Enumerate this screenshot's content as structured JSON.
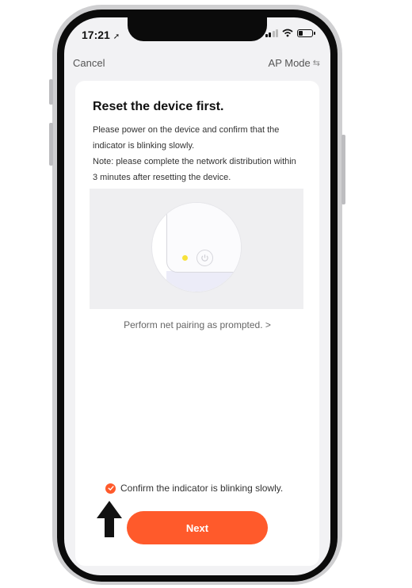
{
  "status_bar": {
    "time": "17:21"
  },
  "nav": {
    "cancel_label": "Cancel",
    "mode_label": "AP Mode"
  },
  "content": {
    "title": "Reset the device first.",
    "description_lines": [
      "Please power on the device and confirm that the",
      "indicator is blinking slowly.",
      "Note: please complete the network distribution within",
      "3 minutes after resetting the device."
    ],
    "pairing_link": "Perform net pairing as prompted. >"
  },
  "confirm": {
    "label": "Confirm the indicator is blinking slowly.",
    "checked": true
  },
  "next_button": {
    "label": "Next"
  },
  "colors": {
    "accent": "#ff5a2b",
    "indicator_led": "#f7e23b",
    "screen_bg": "#f2f2f4"
  },
  "icons": [
    "location-arrow-icon",
    "signal-icon",
    "wifi-icon",
    "battery-icon",
    "swap-icon",
    "power-icon",
    "checkmark-icon",
    "up-arrow-icon"
  ]
}
